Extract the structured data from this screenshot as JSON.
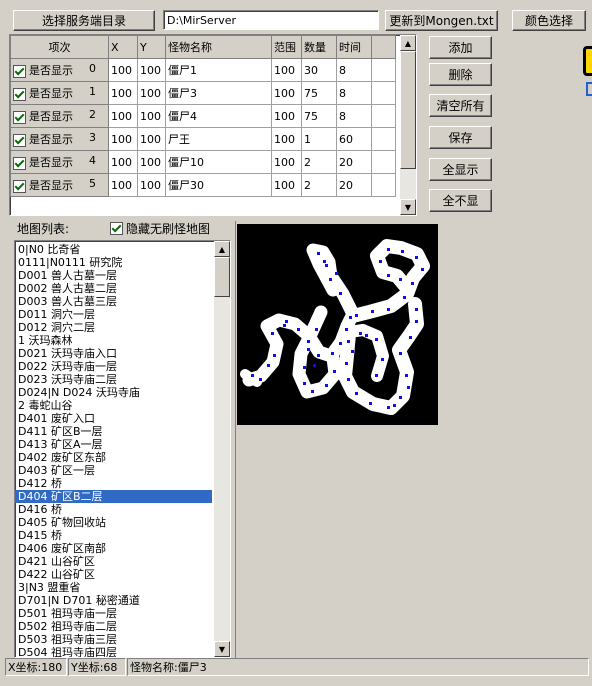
{
  "toolbar": {
    "select_dir_label": "选择服务端目录",
    "dir_path": "D:\\MirServer",
    "update_label": "更新到Mongen.txt",
    "color_label": "颜色选择"
  },
  "grid": {
    "headers": [
      "项次",
      "X",
      "Y",
      "怪物名称",
      "范围",
      "数量",
      "时间"
    ],
    "row_label": "是否显示",
    "rows": [
      {
        "idx": "0",
        "x": "100",
        "y": "100",
        "name": "僵尸1",
        "range": "100",
        "count": "30",
        "time": "8"
      },
      {
        "idx": "1",
        "x": "100",
        "y": "100",
        "name": "僵尸3",
        "range": "100",
        "count": "75",
        "time": "8"
      },
      {
        "idx": "2",
        "x": "100",
        "y": "100",
        "name": "僵尸4",
        "range": "100",
        "count": "75",
        "time": "8"
      },
      {
        "idx": "3",
        "x": "100",
        "y": "100",
        "name": "尸王",
        "range": "100",
        "count": "1",
        "time": "60"
      },
      {
        "idx": "4",
        "x": "100",
        "y": "100",
        "name": "僵尸10",
        "range": "100",
        "count": "2",
        "time": "20"
      },
      {
        "idx": "5",
        "x": "100",
        "y": "100",
        "name": "僵尸30",
        "range": "100",
        "count": "2",
        "time": "20"
      }
    ]
  },
  "actions": {
    "add": "添加",
    "delete": "删除",
    "clear_all": "清空所有",
    "save": "保存",
    "show_all": "全显示",
    "hide_all": "全不显"
  },
  "maplist": {
    "label": "地图列表:",
    "hide_checkbox_label": "隐藏无刷怪地图",
    "selected_index": 19,
    "items": [
      "0|N0 比奇省",
      "0111|N0111 研究院",
      "D001 兽人古墓一层",
      "D002 兽人古墓二层",
      "D003 兽人古墓三层",
      "D011 洞穴一层",
      "D012 洞穴二层",
      "1 沃玛森林",
      "D021 沃玛寺庙入口",
      "D022 沃玛寺庙一层",
      "D023 沃玛寺庙二层",
      "D024|N D024 沃玛寺庙",
      "2 毒蛇山谷",
      "D401 废矿入口",
      "D411 矿区B一层",
      "D413 矿区A一层",
      "D402 废矿区东部",
      "D403 矿区一层",
      "D412 桥",
      "D404 矿区B二层",
      "D416 桥",
      "D405 矿物回收站",
      "D415 桥",
      "D406 废矿区南部",
      "D421 山谷矿区",
      "D422 山谷矿区",
      "3|N3 盟重省",
      "D701|N D701 秘密通道",
      "D501 祖玛寺庙一层",
      "D502 祖玛寺庙二层",
      "D503 祖玛寺庙三层",
      "D504 祖玛寺庙四层"
    ]
  },
  "status": {
    "x_label": "X坐标:180",
    "y_label": "Y坐标:68",
    "monster_label": "怪物名称:僵尸3"
  },
  "colors": {
    "face": "#d4d0c8",
    "selection": "#316ac5",
    "map_bg": "#000000",
    "map_floor": "#ffffff",
    "monster_dot": "#1010e0"
  }
}
